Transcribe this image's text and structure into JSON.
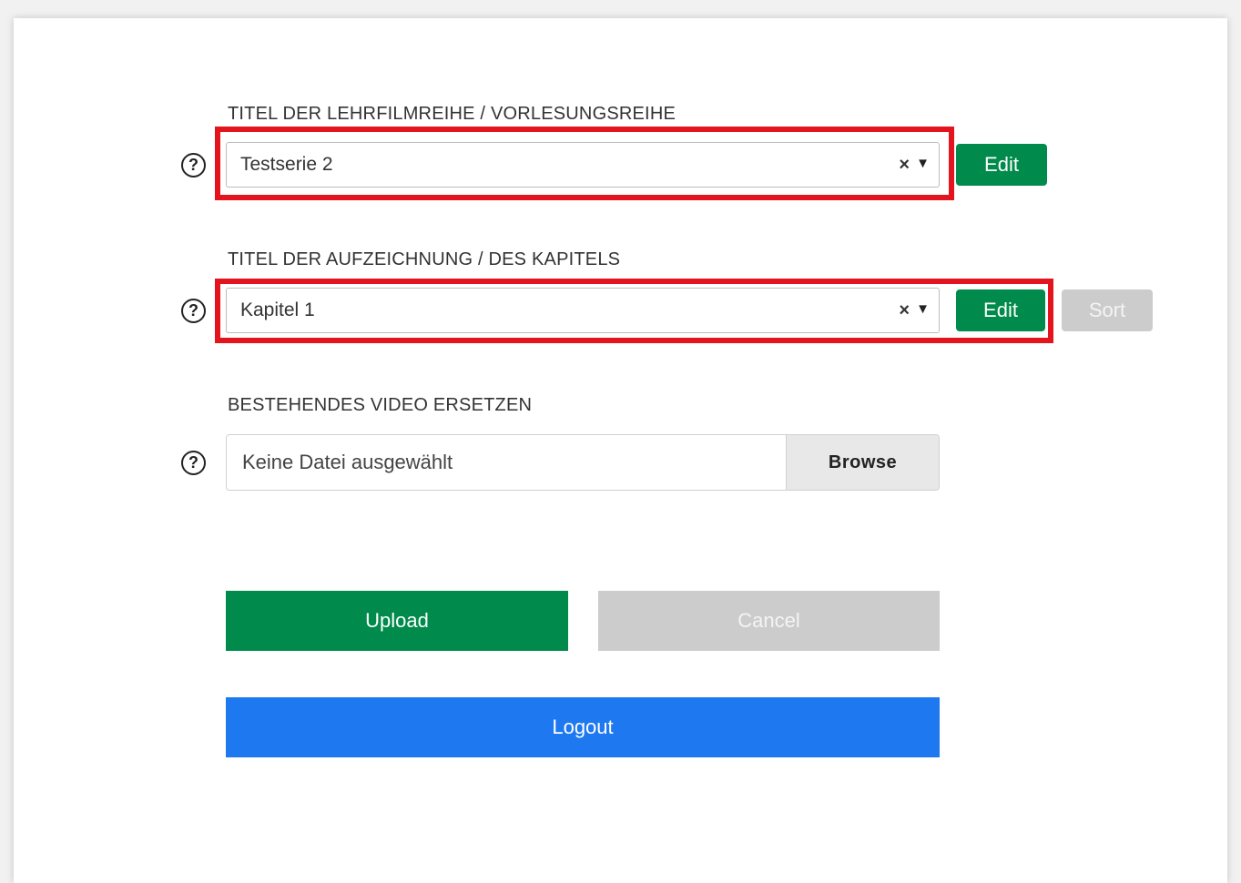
{
  "series": {
    "label": "TITEL DER LEHRFILMREIHE / VORLESUNGSREIHE",
    "help_glyph": "?",
    "value": "Testserie 2",
    "clear_glyph": "×",
    "caret_glyph": "▼",
    "edit_label": "Edit"
  },
  "recording": {
    "label": "TITEL DER AUFZEICHNUNG / DES KAPITELS",
    "help_glyph": "?",
    "value": "Kapitel 1",
    "clear_glyph": "×",
    "caret_glyph": "▼",
    "edit_label": "Edit",
    "sort_label": "Sort"
  },
  "replace_video": {
    "label": "BESTEHENDES VIDEO ERSETZEN",
    "help_glyph": "?",
    "placeholder": "Keine Datei ausgewählt",
    "browse_label": "Browse"
  },
  "actions": {
    "upload_label": "Upload",
    "cancel_label": "Cancel",
    "logout_label": "Logout"
  },
  "colors": {
    "highlight_frame": "#e4141e",
    "primary_green": "#008a4b",
    "disabled_grey": "#cccccc",
    "logout_blue": "#1e78f0"
  },
  "icons": {
    "help": "help-circle-icon",
    "clear": "clear-x-icon",
    "dropdown": "caret-down-icon"
  }
}
